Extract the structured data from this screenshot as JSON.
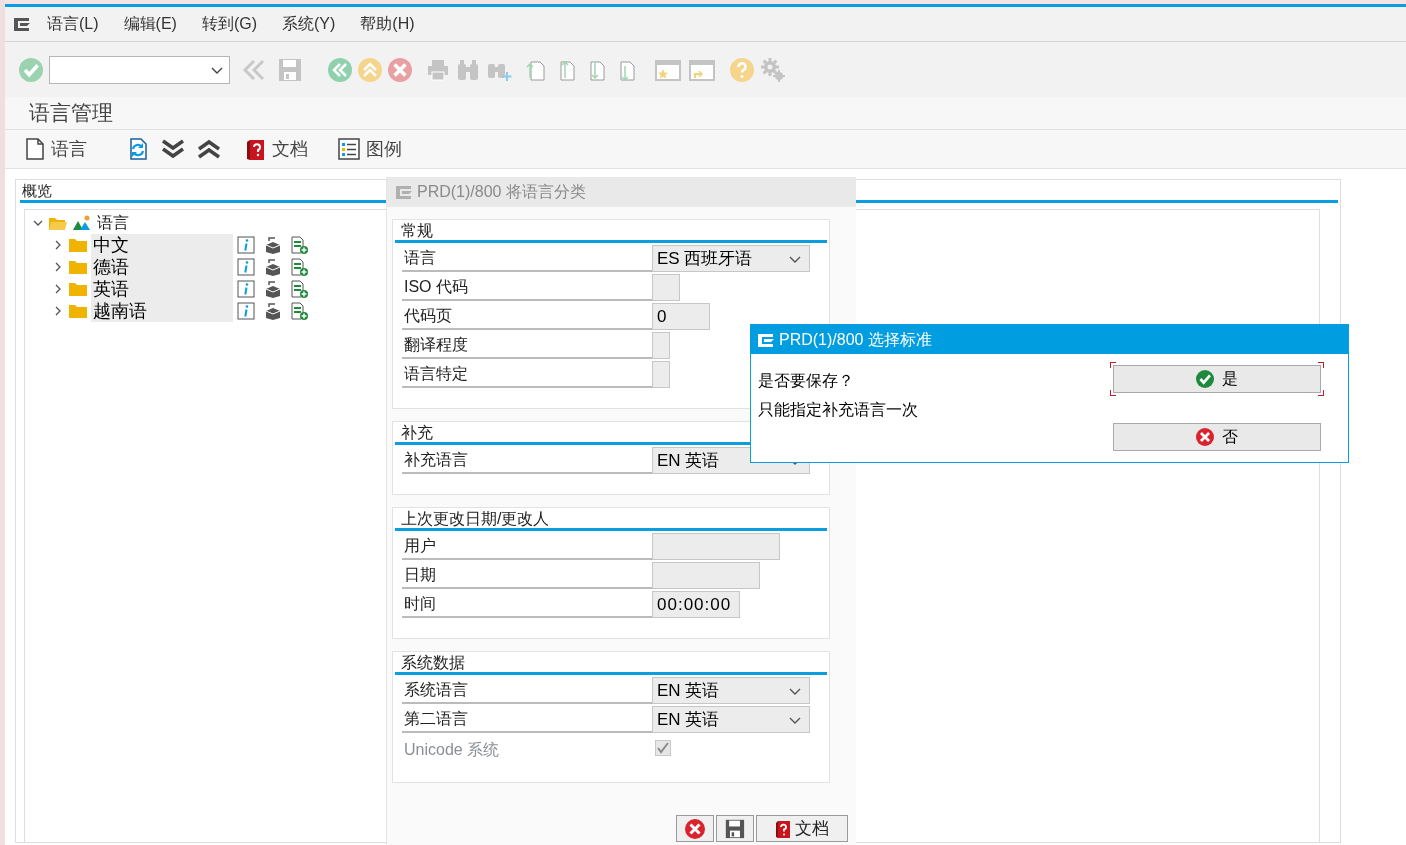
{
  "menu": [
    {
      "label": "语言(L)"
    },
    {
      "label": "编辑(E)"
    },
    {
      "label": "转到(G)"
    },
    {
      "label": "系统(Y)"
    },
    {
      "label": "帮助(H)"
    }
  ],
  "title": "语言管理",
  "app_toolbar": [
    {
      "kind": "create",
      "label": "语言"
    },
    {
      "kind": "refresh"
    },
    {
      "kind": "expand"
    },
    {
      "kind": "collapse"
    },
    {
      "kind": "doc",
      "label": "文档"
    },
    {
      "kind": "legend",
      "label": "图例"
    }
  ],
  "overview": {
    "title": "概览",
    "tree": {
      "label": "语言",
      "expanded": true,
      "children": [
        {
          "label": "中文",
          "expanded": false
        },
        {
          "label": "德语",
          "expanded": false
        },
        {
          "label": "英语",
          "expanded": false
        },
        {
          "label": "越南语",
          "expanded": false
        }
      ]
    }
  },
  "classify_dialog": {
    "title": "PRD(1)/800 将语言分类",
    "groups": [
      {
        "title": "常规",
        "fields": [
          {
            "label": "语言",
            "kind": "dropdown",
            "value": "ES 西班牙语"
          },
          {
            "label": "ISO 代码",
            "kind": "input"
          },
          {
            "label": "代码页",
            "kind": "input",
            "value": "0"
          },
          {
            "label": "翻译程度",
            "kind": "input"
          },
          {
            "label": "语言特定",
            "kind": "input"
          }
        ]
      },
      {
        "title": "补充",
        "fields": [
          {
            "label": "补充语言",
            "kind": "dropdown",
            "value": "EN 英语"
          }
        ]
      },
      {
        "title": "上次更改日期/更改人",
        "fields": [
          {
            "label": "用户",
            "kind": "input"
          },
          {
            "label": "日期",
            "kind": "input"
          },
          {
            "label": "时间",
            "kind": "input",
            "value": "00:00:00"
          }
        ]
      },
      {
        "title": "系统数据",
        "fields": [
          {
            "label": "系统语言",
            "kind": "dropdown",
            "value": "EN 英语"
          },
          {
            "label": "第二语言",
            "kind": "dropdown",
            "value": "EN 英语"
          },
          {
            "label": "Unicode 系统",
            "kind": "checkbox",
            "checked": true,
            "disabled": true
          }
        ]
      }
    ],
    "buttons": [
      {
        "kind": "cancel"
      },
      {
        "kind": "save"
      },
      {
        "kind": "doc",
        "label": "文档"
      }
    ]
  },
  "confirm_dialog": {
    "title": "PRD(1)/800 选择标准",
    "lines": [
      "是否要保存？",
      "只能指定补充语言一次"
    ],
    "buttons": [
      {
        "kind": "yes",
        "label": "是",
        "focused": true
      },
      {
        "kind": "no",
        "label": "否",
        "focused": false
      }
    ]
  }
}
